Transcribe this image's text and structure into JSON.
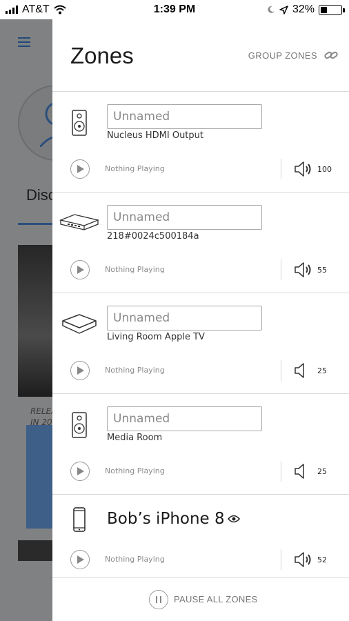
{
  "status_bar": {
    "carrier": "AT&T",
    "time": "1:39 PM",
    "battery_percent": "32%"
  },
  "background_app": {
    "tab_label": "Disc",
    "release_text_line1": "RELEA",
    "release_text_line2": "IN 20"
  },
  "panel": {
    "title": "Zones",
    "group_zones_label": "GROUP ZONES",
    "pause_all_label": "PAUSE ALL ZONES"
  },
  "zones": [
    {
      "device": "speaker-icon",
      "name_placeholder": "Unnamed",
      "subname": "Nucleus HDMI Output",
      "now_playing": "Nothing Playing",
      "volume": "100",
      "volume_icon": "speaker-waves-icon"
    },
    {
      "device": "network-switch-icon",
      "name_placeholder": "Unnamed",
      "subname": "218#0024c500184a",
      "now_playing": "Nothing Playing",
      "volume": "55",
      "volume_icon": "speaker-waves-icon"
    },
    {
      "device": "apple-tv-icon",
      "name_placeholder": "Unnamed",
      "subname": "Living Room Apple TV",
      "now_playing": "Nothing Playing",
      "volume": "25",
      "volume_icon": "speaker-icon"
    },
    {
      "device": "speaker-icon",
      "name_placeholder": "Unnamed",
      "subname": "Media Room",
      "now_playing": "Nothing Playing",
      "volume": "25",
      "volume_icon": "speaker-icon"
    },
    {
      "device": "phone-icon",
      "name": "Bob’s iPhone 8",
      "now_playing": "Nothing Playing",
      "volume": "52",
      "volume_icon": "speaker-waves-icon"
    }
  ],
  "colors": {
    "accent": "#2b4f7c",
    "divider": "#d9d9d9",
    "muted_text": "#8a8a8a",
    "overlay": "#808183"
  }
}
